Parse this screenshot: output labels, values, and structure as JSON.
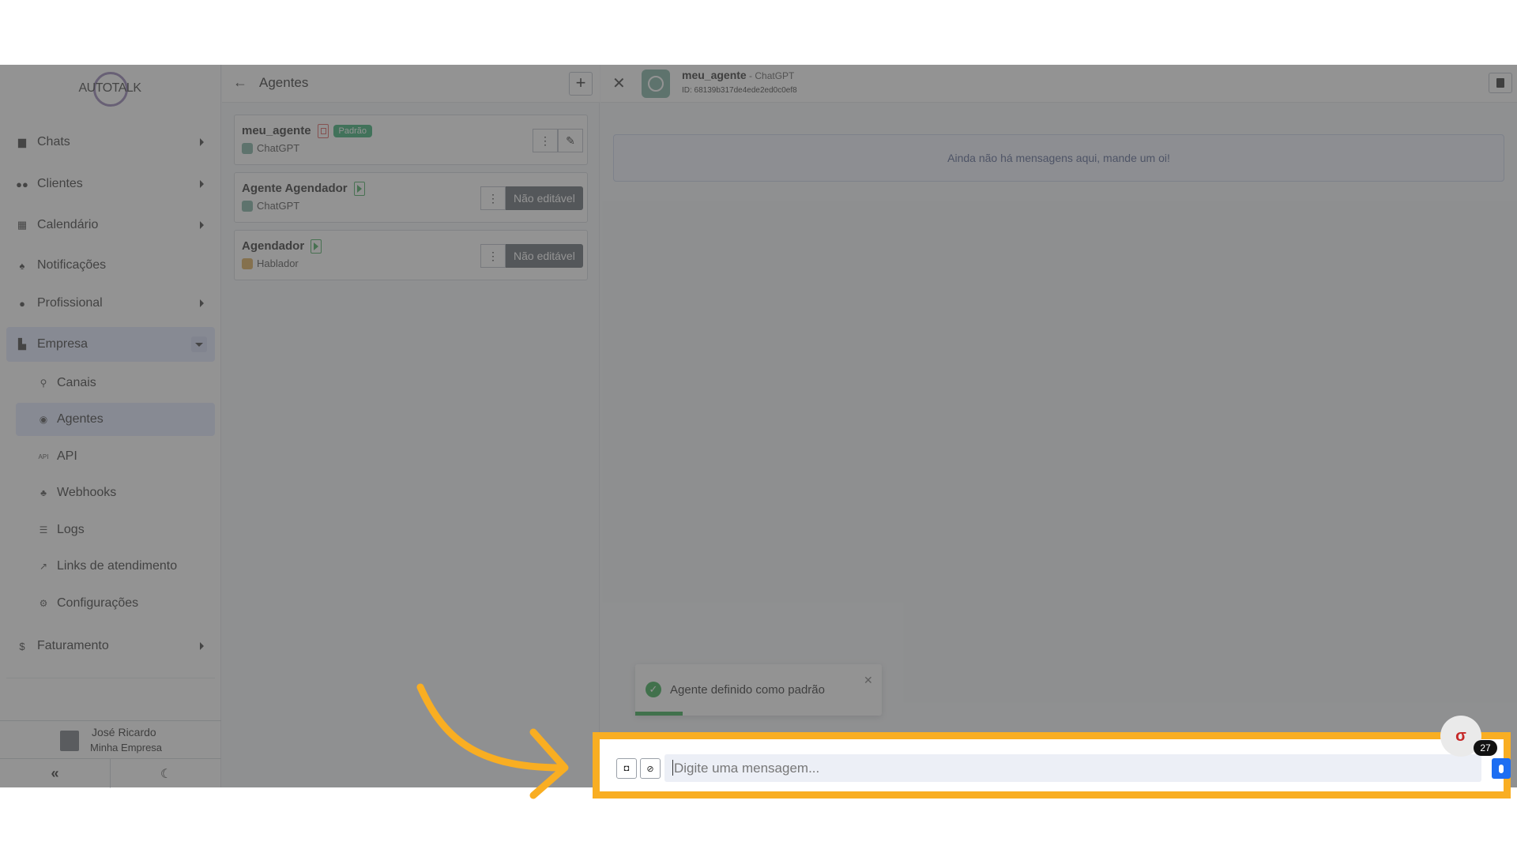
{
  "sidebar": {
    "logo_text": "AUTOTALK",
    "items": [
      {
        "label": "Chats",
        "icon": "chat-icon"
      },
      {
        "label": "Clientes",
        "icon": "users-icon"
      },
      {
        "label": "Calendário",
        "icon": "calendar-icon"
      },
      {
        "label": "Notificações",
        "icon": "bell-icon"
      },
      {
        "label": "Profissional",
        "icon": "user-cog-icon"
      },
      {
        "label": "Empresa",
        "icon": "building-icon"
      },
      {
        "label": "Faturamento",
        "icon": "dollar-icon"
      }
    ],
    "subitems": [
      {
        "label": "Canais",
        "icon": "rocket-icon"
      },
      {
        "label": "Agentes",
        "icon": "robot-icon"
      },
      {
        "label": "API",
        "icon": "api-icon"
      },
      {
        "label": "Webhooks",
        "icon": "webhook-icon"
      },
      {
        "label": "Logs",
        "icon": "list-icon"
      },
      {
        "label": "Links de atendimento",
        "icon": "external-link-icon"
      },
      {
        "label": "Configurações",
        "icon": "gear-icon"
      }
    ],
    "user": {
      "name": "José Ricardo",
      "company": "Minha Empresa"
    }
  },
  "agents": {
    "title": "Agentes",
    "list": [
      {
        "name": "meu_agente",
        "model": "ChatGPT",
        "badge": "Padrão",
        "action": ""
      },
      {
        "name": "Agente Agendador",
        "model": "ChatGPT",
        "badge": "",
        "action": "Não editável"
      },
      {
        "name": "Agendador",
        "model": "Hablador",
        "badge": "",
        "action": "Não editável"
      }
    ]
  },
  "chat": {
    "agent_name": "meu_agente",
    "agent_sep": " - ",
    "agent_model": "ChatGPT",
    "agent_id": "ID: 68139b317de4ede2ed0c0ef8",
    "empty_message": "Ainda não há mensagens aqui, mande um oi!",
    "input_placeholder": "Digite uma mensagem...",
    "toast": "Agente definido como padrão",
    "badge_count": "27"
  },
  "colors": {
    "highlight": "#f9ae22",
    "accent": "#1d6ef2",
    "success": "#28a86b"
  }
}
